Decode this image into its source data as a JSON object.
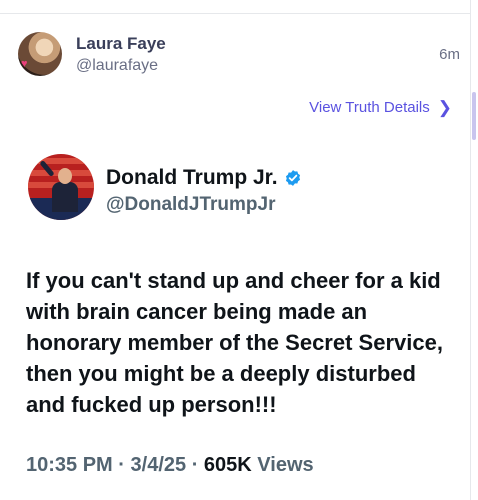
{
  "post": {
    "author_name": "Laura Faye",
    "author_handle": "@laurafaye",
    "time_ago": "6m",
    "view_details_label": "View Truth Details"
  },
  "quoted_post": {
    "author_name": "Donald Trump Jr.",
    "author_handle": "@DonaldJTrumpJr",
    "text": "If you can't stand up and cheer for a kid with brain cancer being made an honorary member of the Secret Service, then you might be a deeply disturbed and fucked up person!!!",
    "time": "10:35 PM",
    "date": "3/4/25",
    "views_count": "605K",
    "views_label": "Views",
    "separator": "·"
  },
  "colors": {
    "accent": "#5a52e0",
    "verified": "#1d9bf0",
    "muted_text": "#536471"
  },
  "icons": {
    "chevron": "chevron-right-icon",
    "verified": "verified-badge-icon"
  }
}
